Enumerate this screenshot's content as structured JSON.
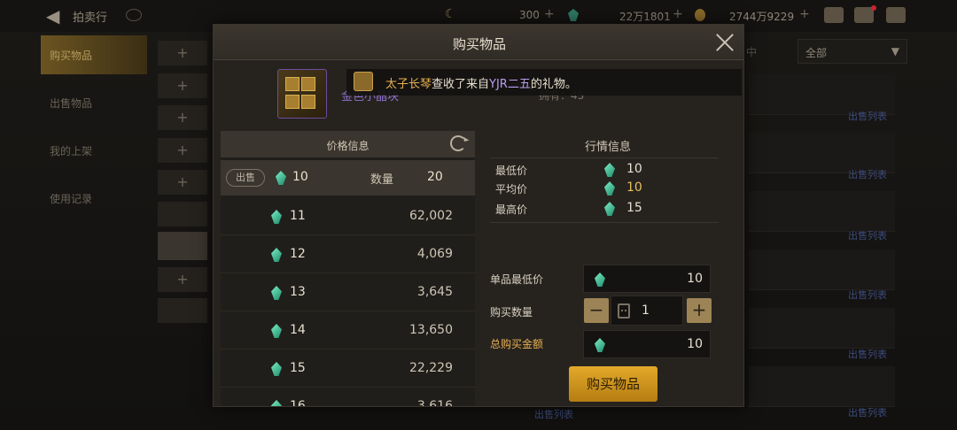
{
  "topbar": {
    "title": "拍卖行",
    "currencies": [
      {
        "icon": "moon-coin-icon",
        "value": "300"
      },
      {
        "icon": "gem-icon",
        "value": "22万1801"
      },
      {
        "icon": "gold-icon",
        "value": "2744万9229"
      }
    ]
  },
  "sidebar": {
    "items": [
      {
        "label": "购买物品",
        "active": true
      },
      {
        "label": "出售物品",
        "active": false
      },
      {
        "label": "我的上架",
        "active": false
      },
      {
        "label": "使用记录",
        "active": false
      }
    ]
  },
  "background": {
    "filter_label": "中",
    "filter_value": "全部",
    "sell_list_link": "出售列表"
  },
  "modal": {
    "title": "购买物品",
    "item": {
      "name": "金色小晶块",
      "owned": "拥有：45"
    },
    "notice": {
      "part1": "太子长琴",
      "part2": "查收了来自",
      "part3": "YJR二五",
      "part4": "的礼物。"
    },
    "price_panel": {
      "title": "价格信息",
      "sell": {
        "tag": "出售",
        "price": "10",
        "qty_label": "数量",
        "qty": "20"
      },
      "rows": [
        {
          "price": "11",
          "qty": "62,002"
        },
        {
          "price": "12",
          "qty": "4,069"
        },
        {
          "price": "13",
          "qty": "3,645"
        },
        {
          "price": "14",
          "qty": "13,650"
        },
        {
          "price": "15",
          "qty": "22,229"
        },
        {
          "price": "16",
          "qty": "3,616"
        }
      ]
    },
    "market": {
      "title": "行情信息",
      "min_label": "最低价",
      "min": "10",
      "avg_label": "平均价",
      "avg": "10",
      "max_label": "最高价",
      "max": "15"
    },
    "form": {
      "unit_label": "单品最低价",
      "unit_value": "10",
      "qty_label": "购买数量",
      "qty_value": "1",
      "total_label": "总购买金额",
      "total_value": "10"
    },
    "buy_button": "购买物品"
  },
  "colors": {
    "accent": "#e3a92a",
    "gem": "#2fb890",
    "item_name": "#8c6fc9"
  }
}
